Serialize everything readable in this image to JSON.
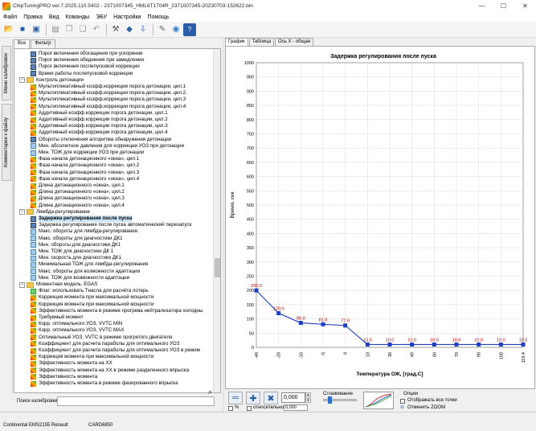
{
  "window": {
    "title": "ChipTuningPRO ver.7.2025.110.5402 - 2371007345_HML6T1704R_2371007345-20230703-152622.bin",
    "min": "—",
    "max": "☐",
    "close": "✕"
  },
  "menu": [
    "Файл",
    "Правка",
    "Вид",
    "Команды",
    "ЭБУ",
    "Настройки",
    "Помощь"
  ],
  "side_tabs": [
    "Меню калибровок",
    "Комментарии к файлу"
  ],
  "left_tabs": [
    "Все",
    "Фильтр"
  ],
  "tree": [
    {
      "label": "Порог включения обогащения при ускорении",
      "icon": "tbl",
      "indent": 1
    },
    {
      "label": "Порог включения обеднения при замедлении",
      "icon": "tbl",
      "indent": 1
    },
    {
      "label": "Порог включения послепусковой коррекции",
      "icon": "tbl",
      "indent": 1
    },
    {
      "label": "Время работы послепусковой коррекции",
      "icon": "tbl",
      "indent": 1
    },
    {
      "label": "Контроль детонации",
      "icon": "folder",
      "indent": 0,
      "expander": "−"
    },
    {
      "label": "Мультипликативный коэфф.коррекции порога детонации, цил.1",
      "icon": "map",
      "indent": 1
    },
    {
      "label": "Мультипликативный коэфф.коррекции порога детонации, цил.2",
      "icon": "map",
      "indent": 1
    },
    {
      "label": "Мультипликативный коэфф.коррекции порога детонации, цил.3",
      "icon": "map",
      "indent": 1
    },
    {
      "label": "Мультипликативный коэфф.коррекции порога детонации, цил.4",
      "icon": "map",
      "indent": 1
    },
    {
      "label": "Аддитивный коэфф.коррекции порога детонации, цил.1",
      "icon": "map",
      "indent": 1
    },
    {
      "label": "Аддитивный коэфф.коррекции порога детонации, цил.2",
      "icon": "map",
      "indent": 1
    },
    {
      "label": "Аддитивный коэфф.коррекции порога детонации, цил.3",
      "icon": "map",
      "indent": 1
    },
    {
      "label": "Аддитивный коэфф.коррекции порога детонации, цил.4",
      "icon": "map",
      "indent": 1
    },
    {
      "label": "Обороты отключения алгоритма обнаружения детонации",
      "icon": "tbl",
      "indent": 1
    },
    {
      "label": "Мин. абсолютное давления для коррекции УОЗ при детонации",
      "icon": "num",
      "indent": 1
    },
    {
      "label": "Мин. ТОЖ для коррекции УОЗ при детонации",
      "icon": "num",
      "indent": 1
    },
    {
      "label": "Фаза начала детонационного «окна», цил.1",
      "icon": "map",
      "indent": 1
    },
    {
      "label": "Фаза начала детонационного «окна», цил.2",
      "icon": "map",
      "indent": 1
    },
    {
      "label": "Фаза начала детонационного «окна», цил.3",
      "icon": "map",
      "indent": 1
    },
    {
      "label": "Фаза начала детонационного «окна», цил.4",
      "icon": "map",
      "indent": 1
    },
    {
      "label": "Длина детонационного «окна», цил.1",
      "icon": "map",
      "indent": 1
    },
    {
      "label": "Длина детонационного «окна», цил.2",
      "icon": "map",
      "indent": 1
    },
    {
      "label": "Длина детонационного «окна», цил.3",
      "icon": "map",
      "indent": 1
    },
    {
      "label": "Длина детонационного «окна», цил.4",
      "icon": "map",
      "indent": 1
    },
    {
      "label": "Лямбда-регулирование",
      "icon": "folder",
      "indent": 0,
      "expander": "−"
    },
    {
      "label": "Задержка регулирования после пуска",
      "icon": "tbl",
      "indent": 1,
      "selected": true
    },
    {
      "label": "Задержка регулирования после пуска автоматический перезапуск",
      "icon": "tbl",
      "indent": 1
    },
    {
      "label": "Макс. обороты для лямбда-регулирования.",
      "icon": "num",
      "indent": 1
    },
    {
      "label": "Макс. обороты для диагностики ДК1",
      "icon": "num",
      "indent": 1
    },
    {
      "label": "Мин. обороты для диагностики ДК1",
      "icon": "num",
      "indent": 1
    },
    {
      "label": "Мин. ТОЖ для диагностики ДК 1",
      "icon": "num",
      "indent": 1
    },
    {
      "label": "Мин. скорость для диагностики ДК1",
      "icon": "num",
      "indent": 1
    },
    {
      "label": "Минимальная ТОЖ для лямбда-регулирования",
      "icon": "num",
      "indent": 1
    },
    {
      "label": "Макс. обороты для возможности адаптации",
      "icon": "num",
      "indent": 1
    },
    {
      "label": "Мин. ТОЖ для возможности адаптации",
      "icon": "num",
      "indent": 1
    },
    {
      "label": "Моментная модель, EGAS",
      "icon": "folder",
      "indent": 0,
      "expander": "−"
    },
    {
      "label": "Флаг: использовать Тнасла для расчёта потерь",
      "icon": "chk",
      "indent": 1
    },
    {
      "label": "Коррекция момента при максимальной мощности",
      "icon": "map",
      "indent": 1
    },
    {
      "label": "Коррекция момента при максимальной мощности",
      "icon": "map",
      "indent": 1
    },
    {
      "label": "Эффективность момента в режиме прогрева нейтрализатора холодны",
      "icon": "map",
      "indent": 1
    },
    {
      "label": "Требуемый момент",
      "icon": "map",
      "indent": 1
    },
    {
      "label": "Корр. оптимального УОЗ, VVTC MIN",
      "icon": "map",
      "indent": 1
    },
    {
      "label": "Корр. оптимального УОЗ, VVTC MAX",
      "icon": "map",
      "indent": 1
    },
    {
      "label": "Оптимальный УОЗ, VVTC в режиме прогретого двигателя",
      "icon": "map",
      "indent": 1
    },
    {
      "label": "Коэффициент для расчета параболы для оптимального УОЗ",
      "icon": "map",
      "indent": 1
    },
    {
      "label": "Коэффициент для расчета параболы для оптимального УОЗ в режим",
      "icon": "map",
      "indent": 1
    },
    {
      "label": "Коррекция момента при максимальной мощности",
      "icon": "map",
      "indent": 1
    },
    {
      "label": "Эффективность момента на XX",
      "icon": "map",
      "indent": 1
    },
    {
      "label": "Эффективность момента на XX в режиме разделенного впрыска",
      "icon": "map",
      "indent": 1
    },
    {
      "label": "Эффективность момента",
      "icon": "map",
      "indent": 1
    },
    {
      "label": "Эффективность момента в режиме фазированного впрыска",
      "icon": "map",
      "indent": 1
    }
  ],
  "search": {
    "label": "Поиск калибровки",
    "value": ""
  },
  "right_tabs": [
    "График",
    "Таблица",
    "Ось X - общая"
  ],
  "chart_data": {
    "type": "line",
    "title": "Задержка регулирования после пуска",
    "xlabel": "Температура ОЖ, [град.С]",
    "ylabel": "Время, сек",
    "x": [
      -40,
      -20,
      -10,
      -5,
      0,
      10,
      30,
      40,
      60,
      70,
      90,
      100,
      119.4
    ],
    "values": [
      200.0,
      120.0,
      86.0,
      81.0,
      77.0,
      10.0,
      10.0,
      10.0,
      10.0,
      10.0,
      10.0,
      10.0,
      10.0
    ],
    "value_labels": [
      "200.0",
      "120.0",
      "86.0",
      "81.0",
      "77.0",
      "10.0",
      "10.0",
      "10.0",
      "10.0",
      "10.0",
      "10.0",
      "10.0",
      "10.0"
    ],
    "x_tick_labels": [
      "-40",
      "-20",
      "-10",
      "-5",
      "0",
      "10",
      "30",
      "40",
      "60",
      "70",
      "90",
      "100",
      "119.4"
    ],
    "y_ticks": [
      0,
      50,
      100,
      150,
      200,
      250,
      300,
      350,
      400,
      450,
      500,
      550,
      600,
      650,
      700,
      750,
      800,
      850,
      900,
      950,
      1000
    ],
    "ylim": [
      0,
      1000
    ],
    "grid": true,
    "x_spacing": "equal",
    "line_color": "#1f3fbf",
    "marker_color": "#1f3fbf",
    "label_color": "#c00000"
  },
  "bottom": {
    "step_value": "0,000",
    "pct_label": "%",
    "rel_label": "относительно",
    "rel_value": "0,000",
    "smooth_label": "Сглаживание",
    "options_label": "Опции",
    "opt_show_all": "Отображать все точки",
    "opt_cancel_zoom": "Отменить ZOOM"
  },
  "status": {
    "ecu": "Continental EMS2155 Renault",
    "id": "CARD6850"
  },
  "colors": {
    "accent": "#2b5ea8",
    "selection": "#cce4f7"
  }
}
